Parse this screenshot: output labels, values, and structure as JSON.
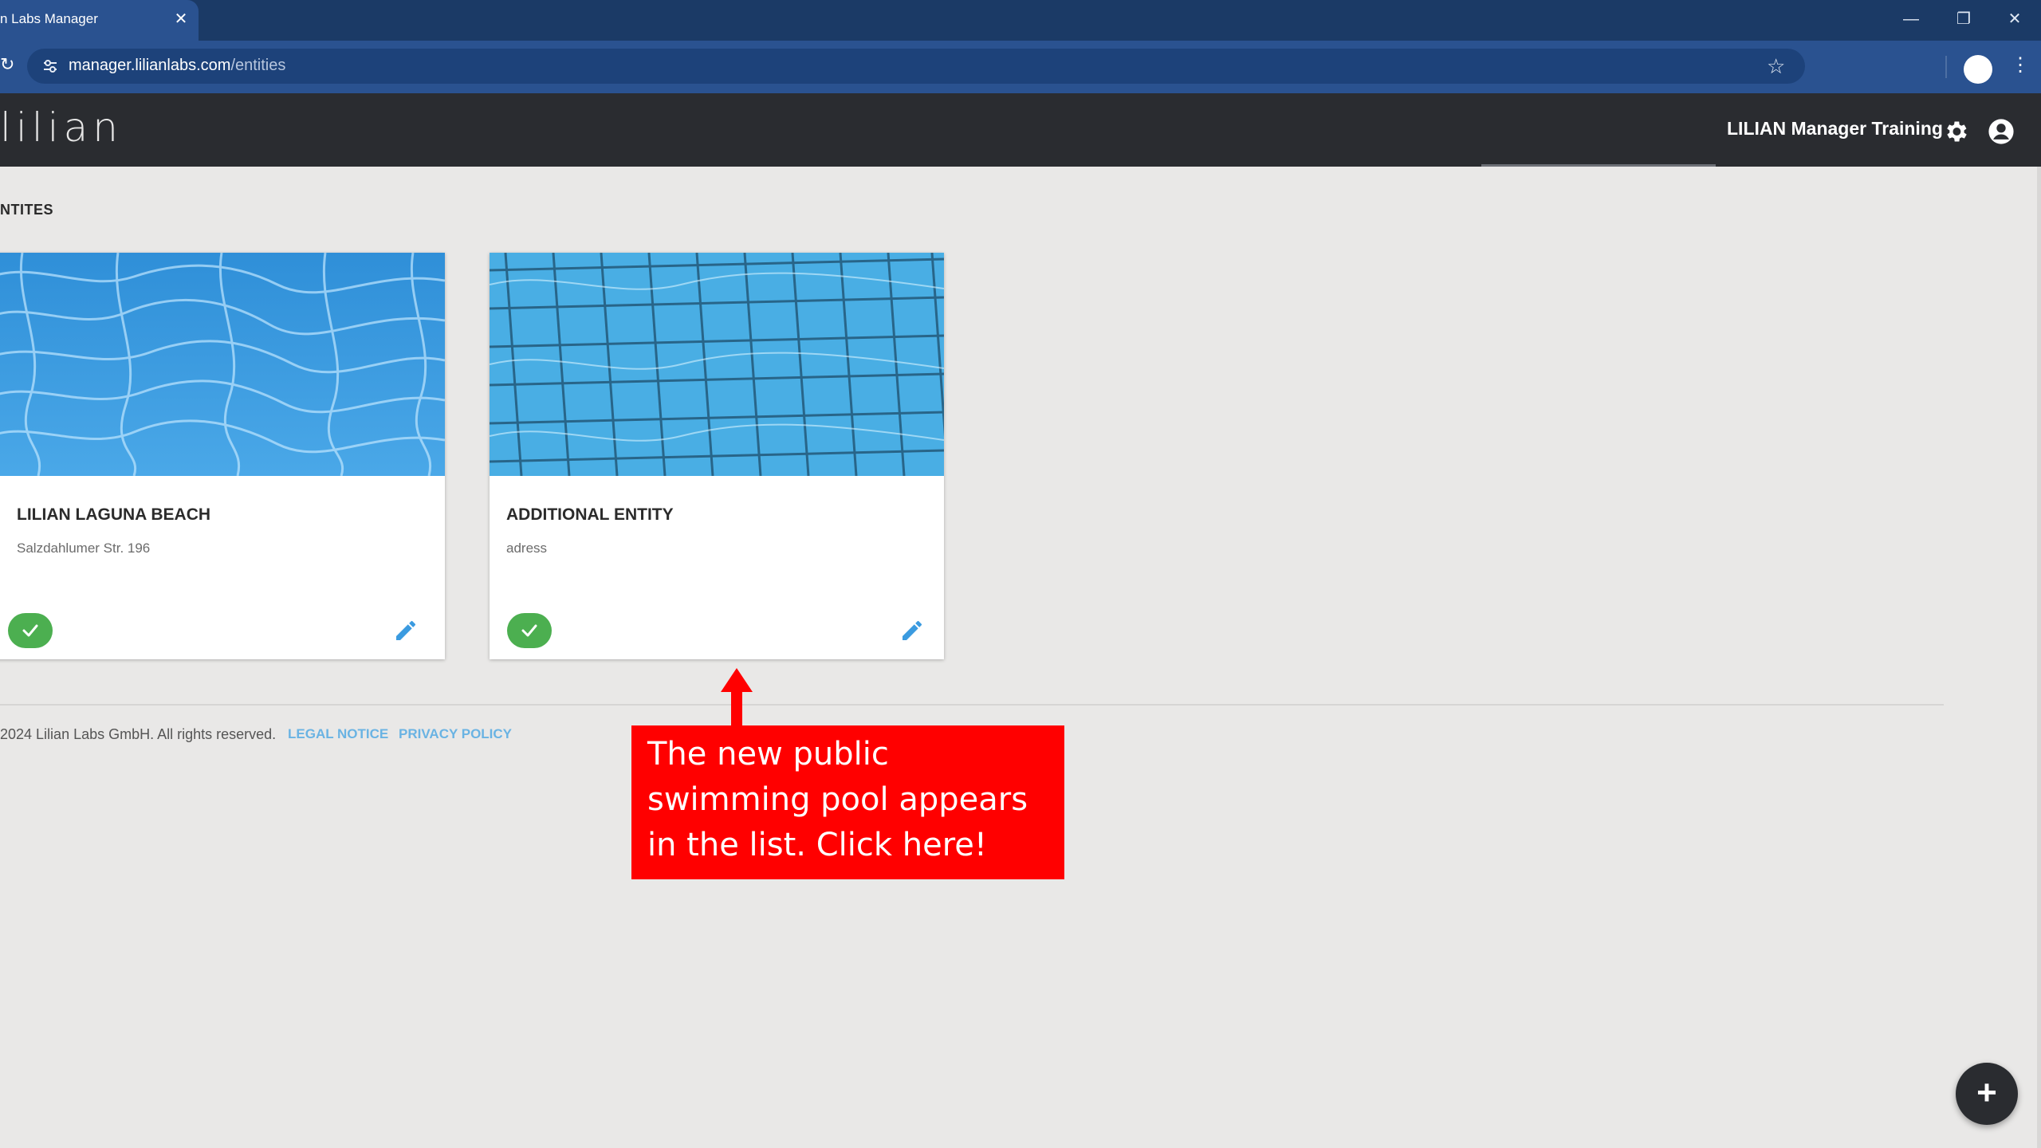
{
  "browser": {
    "tab_title": "n Labs Manager",
    "tab_close": "✕",
    "url_host": "manager.lilianlabs.com",
    "url_path": "/entities",
    "window_minimize": "—",
    "window_restore": "❐",
    "window_close": "✕"
  },
  "header": {
    "logo_text": "lilian",
    "org_name": "LILIAN Manager Training"
  },
  "main": {
    "section_title": "NTITES",
    "entities": [
      {
        "name": "LILIAN LAGUNA BEACH",
        "address": "Salzdahlumer Str. 196",
        "status": "active"
      },
      {
        "name": "ADDITIONAL ENTITY",
        "address": "adress",
        "status": "active"
      }
    ]
  },
  "footer": {
    "copyright": "2024 Lilian Labs GmbH. All rights reserved.",
    "legal_notice": "LEGAL NOTICE",
    "privacy_policy": "PRIVACY POLICY"
  },
  "callout": {
    "text": "The new public swimming pool appears in the list. Click here!"
  },
  "fab": {
    "label": "+"
  },
  "colors": {
    "tab_bar": "#1b3a66",
    "address_bar": "#2a5290",
    "app_header": "#2a2c30",
    "status_green": "#4caf50",
    "edit_blue": "#3b9be0",
    "link_blue": "#6ab3e3",
    "callout_red": "#ff0000"
  },
  "icons": [
    "reload-icon",
    "tune-icon",
    "star-icon",
    "kebab-icon",
    "gear-icon",
    "account-icon",
    "check-icon",
    "pencil-icon",
    "plus-icon"
  ]
}
